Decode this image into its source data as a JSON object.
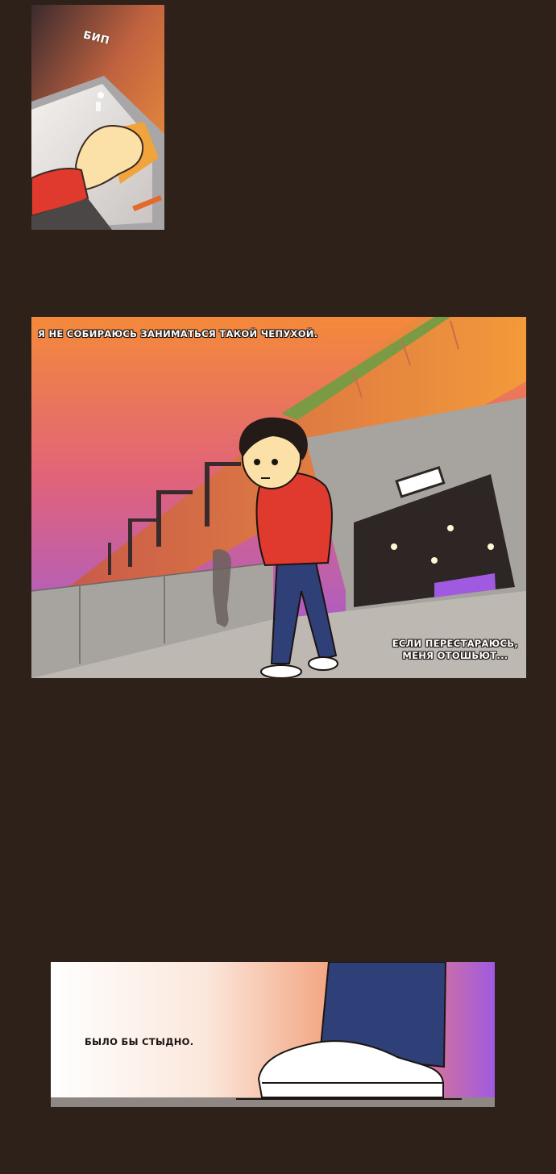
{
  "panels": {
    "panel1": {
      "sfx": "БИП"
    },
    "panel2": {
      "caption_top": "Я НЕ СОБИРАЮСЬ ЗАНИМАТЬСЯ ТАКОЙ ЧЕПУХОЙ.",
      "caption_bottom_line1": "ЕСЛИ ПЕРЕСТАРАЮСЬ,",
      "caption_bottom_line2": "МЕНЯ ОТОШЬЮТ..."
    },
    "panel3": {
      "caption": "БЫЛО БЫ СТЫДНО."
    }
  },
  "colors": {
    "background": "#2e2119",
    "sunset_orange": "#f2883a",
    "sunset_purple": "#9a5ce0",
    "hoodie_red": "#e0392e",
    "jeans_blue": "#2f3f78"
  }
}
